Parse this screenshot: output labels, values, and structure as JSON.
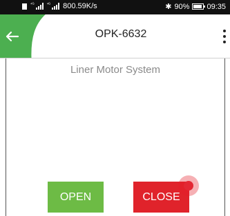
{
  "status_bar": {
    "net_speed": "800.59K/s",
    "signal_1_label": "⁴ᴳ",
    "signal_2_label": "⁴ᴳ",
    "bluetooth": "✱",
    "battery": "90%",
    "time": "09:35"
  },
  "app_bar": {
    "title": "OPK-6632",
    "accent_color": "#4caf50"
  },
  "main": {
    "subtitle": "Liner Motor System",
    "open_label": "OPEN",
    "close_label": "CLOSE",
    "open_color": "#6dbb45",
    "close_color": "#e0232b"
  },
  "icons": [
    "sim-icon",
    "signal-icon",
    "bluetooth-icon",
    "battery-icon",
    "back-arrow-icon",
    "overflow-menu-icon"
  ]
}
